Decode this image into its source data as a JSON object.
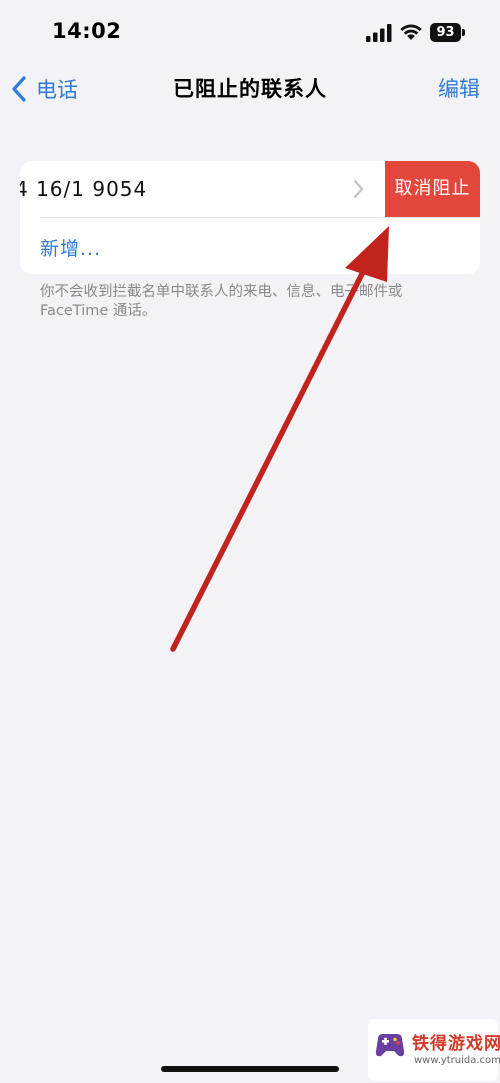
{
  "status_bar": {
    "time": "14:02",
    "battery": "93",
    "icons": [
      "cellular-signal-icon",
      "wifi-icon",
      "battery-icon"
    ]
  },
  "nav": {
    "back_label": "电话",
    "title": "已阻止的联系人",
    "edit_label": "编辑"
  },
  "blocked_list": {
    "items": [
      {
        "number": "4 16/1 9054",
        "action_label": "取消阻止"
      }
    ],
    "add_label": "新增..."
  },
  "footer_note": "你不会收到拦截名单中联系人的来电、信息、电子邮件或FaceTime 通话。",
  "watermark": {
    "name": "铁得游戏网",
    "url": "www.ytruida.com"
  },
  "colors": {
    "background": "#f2f2f7",
    "accent": "#2f7bd9",
    "destructive": "#e3463b",
    "annotation_arrow": "#c0241c"
  }
}
